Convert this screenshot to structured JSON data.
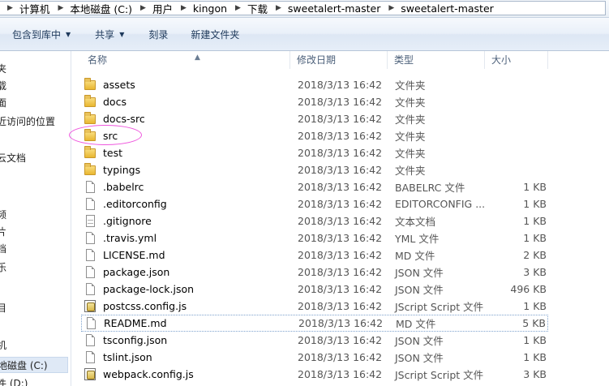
{
  "breadcrumbs": [
    "计算机",
    "本地磁盘 (C:)",
    "用户",
    "kingon",
    "下载",
    "sweetalert-master",
    "sweetalert-master"
  ],
  "toolbar": {
    "include_library": "包含到库中",
    "share": "共享",
    "burn": "刻录",
    "new_folder": "新建文件夹"
  },
  "nav": {
    "items": [
      "夹",
      "载",
      "面",
      "近访问的位置",
      "云文档",
      "频",
      "片",
      "档",
      "乐",
      "目",
      "机",
      "地磁盘 (C:)",
      "件 (D:)"
    ]
  },
  "columns": {
    "name": "名称",
    "date": "修改日期",
    "type": "类型",
    "size": "大小"
  },
  "files": [
    {
      "name": "assets",
      "date": "2018/3/13 16:42",
      "type": "文件夹",
      "size": "",
      "icon": "folder-icon"
    },
    {
      "name": "docs",
      "date": "2018/3/13 16:42",
      "type": "文件夹",
      "size": "",
      "icon": "folder-icon"
    },
    {
      "name": "docs-src",
      "date": "2018/3/13 16:42",
      "type": "文件夹",
      "size": "",
      "icon": "folder-icon"
    },
    {
      "name": "src",
      "date": "2018/3/13 16:42",
      "type": "文件夹",
      "size": "",
      "icon": "folder-icon"
    },
    {
      "name": "test",
      "date": "2018/3/13 16:42",
      "type": "文件夹",
      "size": "",
      "icon": "folder-icon"
    },
    {
      "name": "typings",
      "date": "2018/3/13 16:42",
      "type": "文件夹",
      "size": "",
      "icon": "folder-icon"
    },
    {
      "name": ".babelrc",
      "date": "2018/3/13 16:42",
      "type": "BABELRC 文件",
      "size": "1 KB",
      "icon": "file-icon"
    },
    {
      "name": ".editorconfig",
      "date": "2018/3/13 16:42",
      "type": "EDITORCONFIG ...",
      "size": "1 KB",
      "icon": "file-icon"
    },
    {
      "name": ".gitignore",
      "date": "2018/3/13 16:42",
      "type": "文本文档",
      "size": "1 KB",
      "icon": "text-file-icon"
    },
    {
      "name": ".travis.yml",
      "date": "2018/3/13 16:42",
      "type": "YML 文件",
      "size": "1 KB",
      "icon": "file-icon"
    },
    {
      "name": "LICENSE.md",
      "date": "2018/3/13 16:42",
      "type": "MD 文件",
      "size": "2 KB",
      "icon": "file-icon"
    },
    {
      "name": "package.json",
      "date": "2018/3/13 16:42",
      "type": "JSON 文件",
      "size": "3 KB",
      "icon": "file-icon"
    },
    {
      "name": "package-lock.json",
      "date": "2018/3/13 16:42",
      "type": "JSON 文件",
      "size": "496 KB",
      "icon": "file-icon"
    },
    {
      "name": "postcss.config.js",
      "date": "2018/3/13 16:42",
      "type": "JScript Script 文件",
      "size": "1 KB",
      "icon": "script-icon"
    },
    {
      "name": "README.md",
      "date": "2018/3/13 16:42",
      "type": "MD 文件",
      "size": "5 KB",
      "icon": "file-icon"
    },
    {
      "name": "tsconfig.json",
      "date": "2018/3/13 16:42",
      "type": "JSON 文件",
      "size": "1 KB",
      "icon": "file-icon"
    },
    {
      "name": "tslint.json",
      "date": "2018/3/13 16:42",
      "type": "JSON 文件",
      "size": "1 KB",
      "icon": "file-icon"
    },
    {
      "name": "webpack.config.js",
      "date": "2018/3/13 16:42",
      "type": "JScript Script 文件",
      "size": "3 KB",
      "icon": "script-icon"
    }
  ],
  "focused_file": "README.md",
  "highlighted_file": "src",
  "colors": {
    "highlight_oval": "#ee55dd",
    "header_text": "#4c607a",
    "toolbar_text": "#1e395b"
  }
}
